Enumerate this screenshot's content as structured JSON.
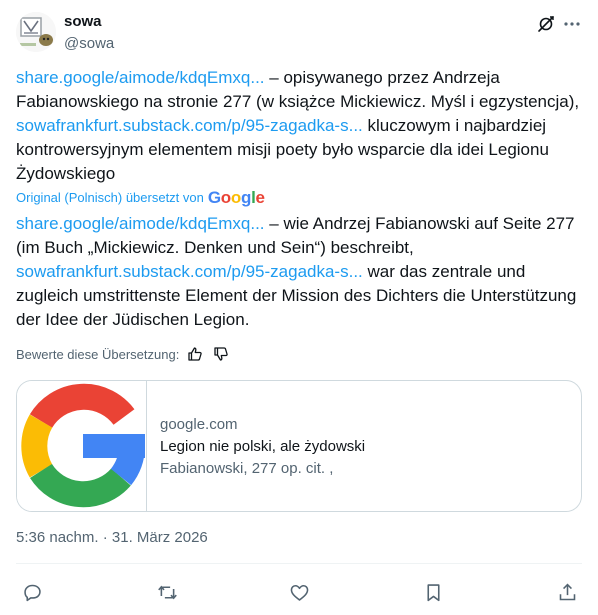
{
  "author": {
    "display_name": "sowa",
    "handle": "@sowa"
  },
  "header_icons": [
    "grok-icon",
    "more-icon"
  ],
  "original_text": {
    "link1": "share.google/aimode/kdqEmxq...",
    "part1": " – opisywanego przez Andrzeja Fabianowskiego na stronie 277 (w książce Mickiewicz. Myśl i egzystencja), ",
    "link2": "sowafrankfurt.substack.com/p/95-zagadka-s...",
    "part2": " kluczowym i najbardziej kontrowersyjnym elementem misji poety było wsparcie dla idei Legionu Żydowskiego"
  },
  "translation": {
    "label": "Original (Polnisch) übersetzt von",
    "provider": "Google",
    "link1": "share.google/aimode/kdqEmxq...",
    "part1": " – wie Andrzej Fabianowski auf Seite 277 (im Buch „Mickiewicz. Denken und Sein“) beschreibt, ",
    "link2": "sowafrankfurt.substack.com/p/95-zagadka-s...",
    "part2": " war das zentrale und zugleich umstrittenste Element der Mission des Dichters die Unterstützung der Idee der Jüdischen Legion."
  },
  "rate_translation": {
    "label": "Bewerte diese Übersetzung:"
  },
  "card": {
    "domain": "google.com",
    "title": "Legion nie polski, ale żydowski",
    "description": "Fabianowski, 277 op. cit. ,"
  },
  "timestamp": "5:36 nachm. · 31. März 2026",
  "actions": [
    "reply-icon",
    "retweet-icon",
    "like-icon",
    "bookmark-icon",
    "share-icon"
  ],
  "colors": {
    "link": "#1d9bf0",
    "secondary_text": "#536471",
    "border": "#cfd9de"
  }
}
